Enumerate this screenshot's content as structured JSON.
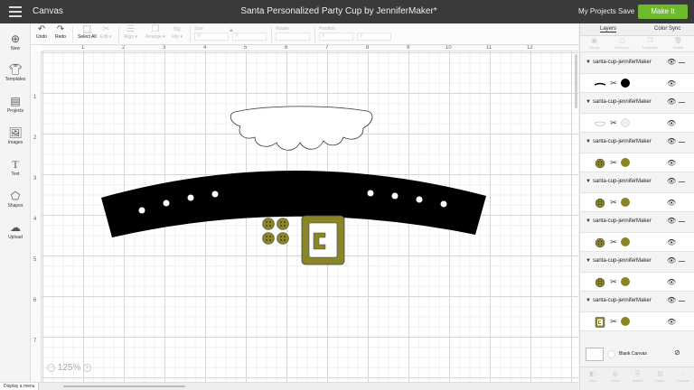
{
  "topbar": {
    "app_name": "Canvas",
    "document_title": "Santa Personalized Party Cup by JenniferMaker*",
    "my_projects": "My Projects",
    "save": "Save",
    "make_it": "Make It"
  },
  "toolbar": {
    "undo": "Undo",
    "redo": "Redo",
    "select_all": "Select All",
    "edit": "Edit ▾",
    "align": "Align ▾",
    "arrange": "Arrange ▾",
    "flip": "Flip ▾",
    "size_label": "Size",
    "w": "W",
    "h": "H",
    "rotate_label": "Rotate",
    "position_label": "Position",
    "x": "X",
    "y": "Y"
  },
  "sidebar": {
    "items": [
      {
        "label": "New",
        "icon": "plus-circle-icon"
      },
      {
        "label": "Templates",
        "icon": "shirt-icon"
      },
      {
        "label": "Projects",
        "icon": "projects-icon"
      },
      {
        "label": "Images",
        "icon": "image-icon"
      },
      {
        "label": "Text",
        "icon": "text-icon"
      },
      {
        "label": "Shapes",
        "icon": "shapes-icon"
      },
      {
        "label": "Upload",
        "icon": "upload-cloud-icon"
      }
    ]
  },
  "canvas": {
    "ruler_top": [
      "1",
      "2",
      "3",
      "4",
      "5",
      "6",
      "7",
      "8",
      "9",
      "10",
      "11",
      "12"
    ],
    "ruler_left": [
      "1",
      "2",
      "3",
      "4",
      "5",
      "6",
      "7"
    ],
    "zoom": "125%"
  },
  "bottombar": {
    "display_menu": "Display a menu"
  },
  "panel": {
    "tabs": [
      "Layers",
      "Color Sync"
    ],
    "actions": [
      "Group",
      "UnGroup",
      "Duplicate",
      "Delete"
    ],
    "layers": [
      {
        "name": "santa-cup-jenniferMaker",
        "swatch": "#000000",
        "thumb": "line"
      },
      {
        "name": "santa-cup-jenniferMaker",
        "swatch": "#eeeeee",
        "thumb": "cloud"
      },
      {
        "name": "santa-cup-jenniferMaker",
        "swatch": "#8a8526",
        "thumb": "button"
      },
      {
        "name": "santa-cup-jenniferMaker",
        "swatch": "#8a8526",
        "thumb": "button"
      },
      {
        "name": "santa-cup-jenniferMaker",
        "swatch": "#8a8526",
        "thumb": "button"
      },
      {
        "name": "santa-cup-jenniferMaker",
        "swatch": "#8a8526",
        "thumb": "button"
      },
      {
        "name": "santa-cup-jenniferMaker",
        "swatch": "#8a8526",
        "thumb": "buckle"
      }
    ],
    "blank_canvas": "Blank Canvas",
    "bottom_actions": [
      "Slice",
      "Weld",
      "Attach",
      "Flatten",
      "Contour"
    ]
  },
  "colors": {
    "topbar": "#3a3a3a",
    "make_it": "#6fba2c",
    "olive": "#8a8526",
    "belt": "#000000"
  }
}
